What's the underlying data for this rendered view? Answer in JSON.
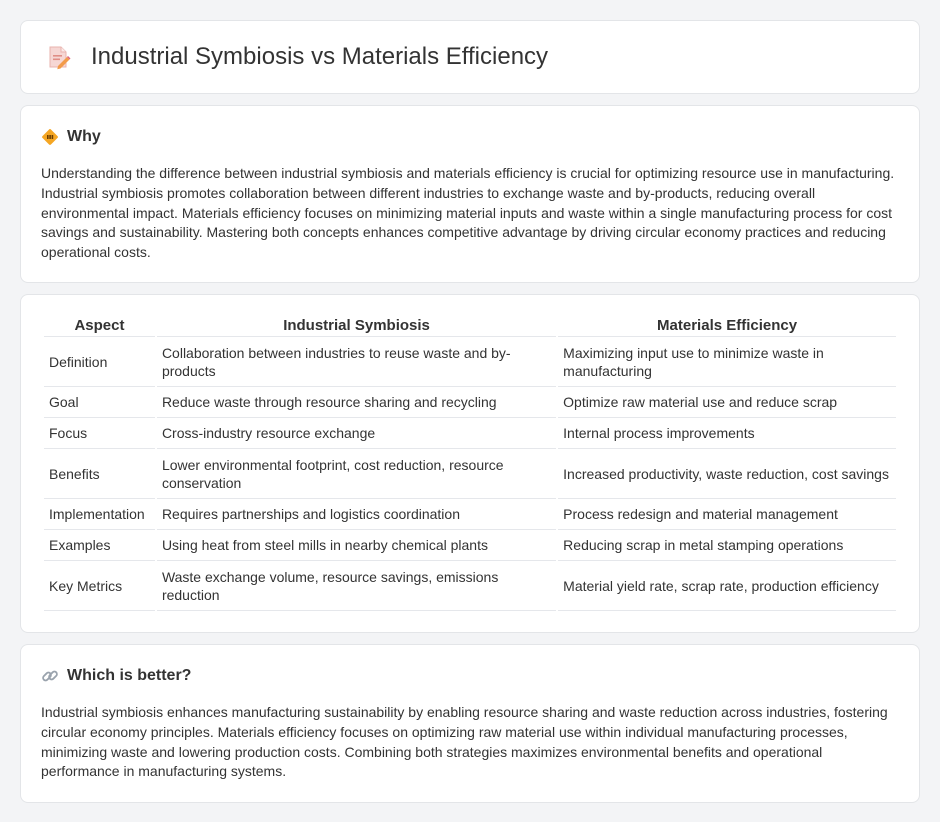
{
  "header": {
    "title": "Industrial Symbiosis vs Materials Efficiency",
    "icon": "document-pencil-icon"
  },
  "why": {
    "heading": "Why",
    "icon": "diamond-sign-icon",
    "text": "Understanding the difference between industrial symbiosis and materials efficiency is crucial for optimizing resource use in manufacturing. Industrial symbiosis promotes collaboration between different industries to exchange waste and by-products, reducing overall environmental impact. Materials efficiency focuses on minimizing material inputs and waste within a single manufacturing process for cost savings and sustainability. Mastering both concepts enhances competitive advantage by driving circular economy practices and reducing operational costs."
  },
  "comparison": {
    "headers": [
      "Aspect",
      "Industrial Symbiosis",
      "Materials Efficiency"
    ],
    "rows": [
      [
        "Definition",
        "Collaboration between industries to reuse waste and by-products",
        "Maximizing input use to minimize waste in manufacturing"
      ],
      [
        "Goal",
        "Reduce waste through resource sharing and recycling",
        "Optimize raw material use and reduce scrap"
      ],
      [
        "Focus",
        "Cross-industry resource exchange",
        "Internal process improvements"
      ],
      [
        "Benefits",
        "Lower environmental footprint, cost reduction, resource conservation",
        "Increased productivity, waste reduction, cost savings"
      ],
      [
        "Implementation",
        "Requires partnerships and logistics coordination",
        "Process redesign and material management"
      ],
      [
        "Examples",
        "Using heat from steel mills in nearby chemical plants",
        "Reducing scrap in metal stamping operations"
      ],
      [
        "Key Metrics",
        "Waste exchange volume, resource savings, emissions reduction",
        "Material yield rate, scrap rate, production efficiency"
      ]
    ]
  },
  "better": {
    "heading": "Which is better?",
    "icon": "link-icon",
    "text": "Industrial symbiosis enhances manufacturing sustainability by enabling resource sharing and waste reduction across industries, fostering circular economy principles. Materials efficiency focuses on optimizing raw material use within individual manufacturing processes, minimizing waste and lowering production costs. Combining both strategies maximizes environmental benefits and operational performance in manufacturing systems."
  }
}
